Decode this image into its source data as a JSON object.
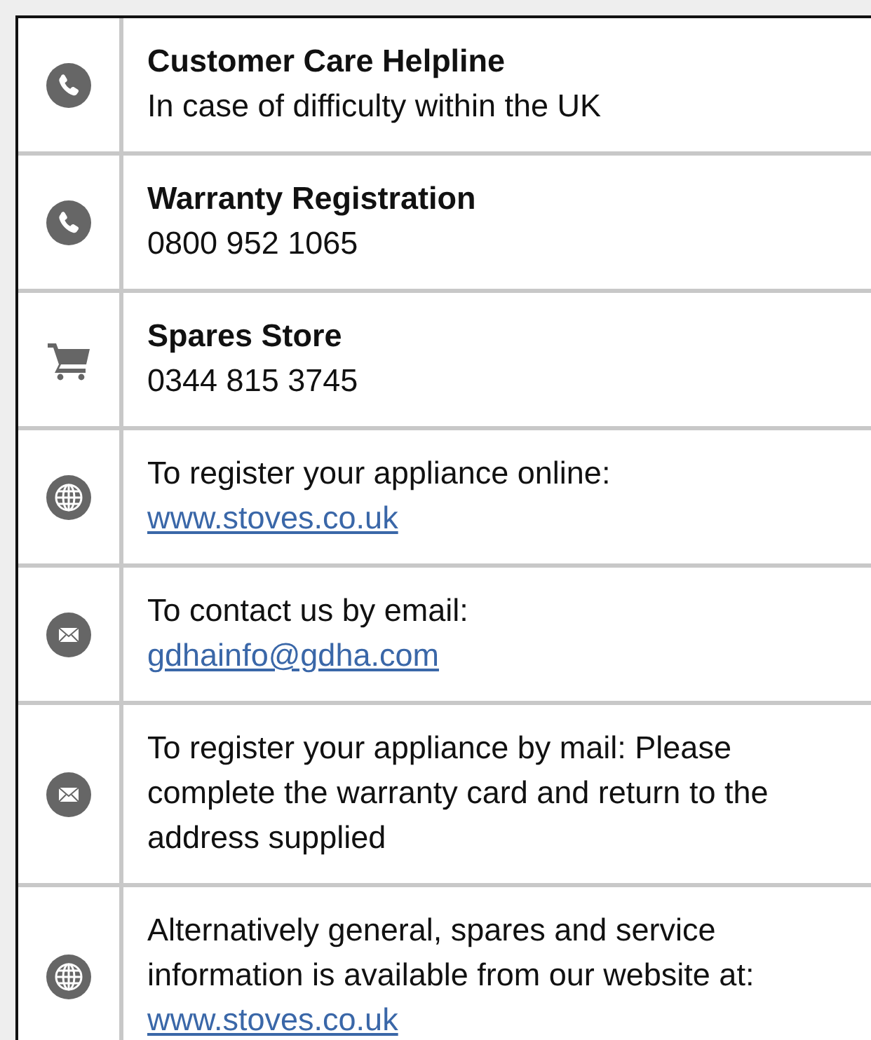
{
  "rows": [
    {
      "kind": "phone",
      "title": "Customer Care Helpline",
      "text": "In case of difficulty within the UK"
    },
    {
      "kind": "phone",
      "title": "Warranty Registration",
      "text": "0800 952 1065"
    },
    {
      "kind": "cart",
      "title": "Spares Store",
      "text": "0344 815 3745"
    },
    {
      "kind": "globe",
      "text": "To register your appliance online:",
      "link_line": "www.stoves.co.uk"
    },
    {
      "kind": "mail",
      "text": "To contact us by email:",
      "link_line": "gdhainfo@gdha.com"
    },
    {
      "kind": "mail",
      "text": "To register your appliance by mail: Please complete the warranty card and return to the address supplied"
    },
    {
      "kind": "globe",
      "text": "Alternatively general, spares and service information is available from our website at:",
      "link": "www.stoves.co.uk"
    }
  ]
}
